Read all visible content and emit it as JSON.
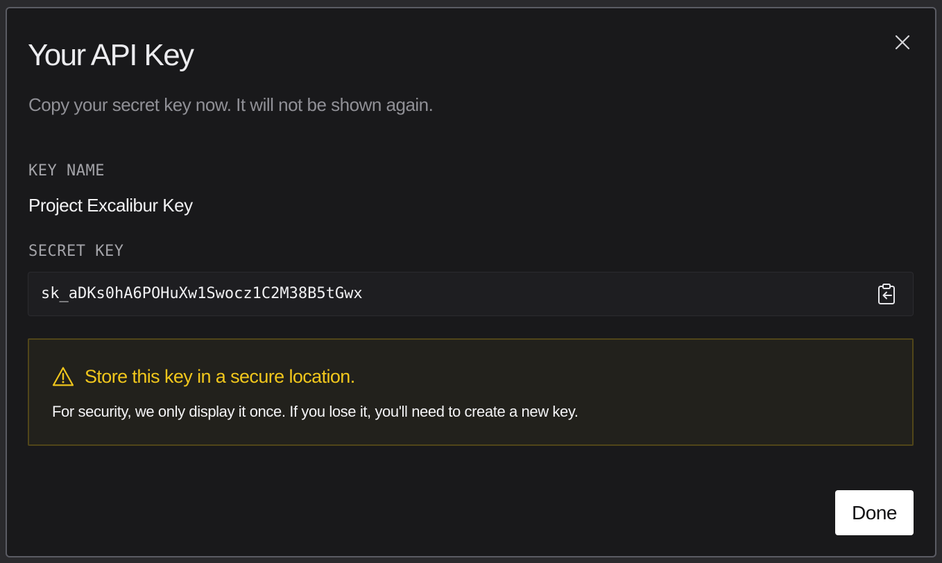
{
  "dialog": {
    "title": "Your API Key",
    "subtitle": "Copy your secret key now. It will not be shown again.",
    "close_icon": "close-icon"
  },
  "fields": {
    "key_name_label": "KEY NAME",
    "key_name_value": "Project Excalibur Key",
    "secret_key_label": "SECRET KEY",
    "secret_key_value": "sk_aDKs0hA6POHuXw1Swocz1C2M38B5tGwx",
    "copy_icon": "clipboard-copy-icon"
  },
  "warning": {
    "icon": "warning-triangle-icon",
    "title": "Store this key in a secure location.",
    "body": "For security, we only display it once. If you lose it, you'll need to create a new key.",
    "accent_color": "#f0c61c"
  },
  "actions": {
    "done_label": "Done"
  }
}
